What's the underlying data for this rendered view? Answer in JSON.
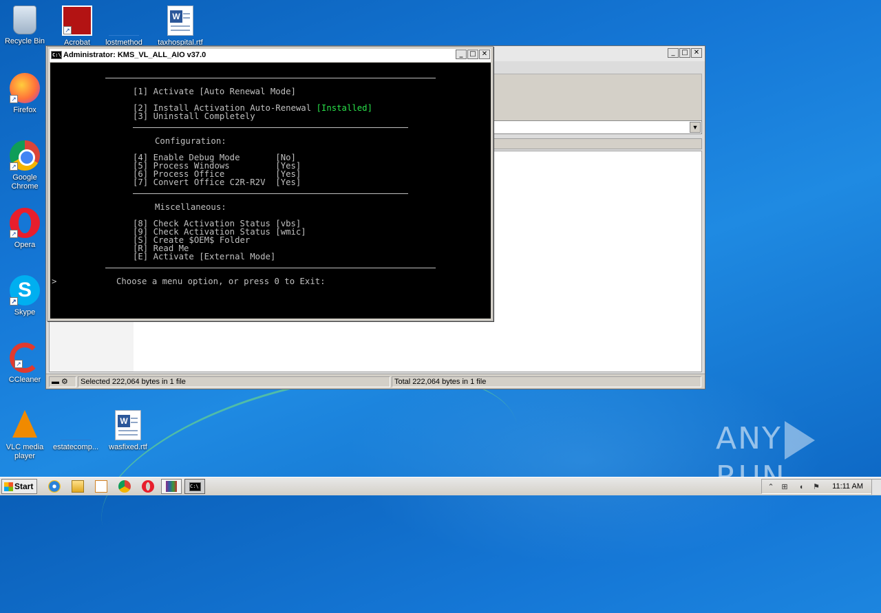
{
  "desktop": {
    "icons": [
      {
        "label": "Recycle Bin",
        "icon": "recycle-bin-icon"
      },
      {
        "label": "Acrobat",
        "icon": "acrobat-icon"
      },
      {
        "label": "lostmethod",
        "icon": "file-icon"
      },
      {
        "label": "taxhospital.rtf",
        "icon": "word-document-icon"
      },
      {
        "label": "Firefox",
        "icon": "firefox-icon"
      },
      {
        "label": "Google Chrome",
        "icon": "chrome-icon"
      },
      {
        "label": "Opera",
        "icon": "opera-icon"
      },
      {
        "label": "Skype",
        "icon": "skype-icon"
      },
      {
        "label": "CCleaner",
        "icon": "ccleaner-icon"
      },
      {
        "label": "VLC media player",
        "icon": "vlc-icon"
      },
      {
        "label": "estatecomp...",
        "icon": "file-icon"
      },
      {
        "label": "wasfixed.rtf",
        "icon": "word-document-icon"
      }
    ]
  },
  "console": {
    "title": "Administrator:  KMS_VL_ALL_AIO v37.0",
    "lines": {
      "opt1": "[1] Activate [Auto Renewal Mode]",
      "opt2": "[2] Install Activation Auto-Renewal ",
      "opt2_status": "[Installed]",
      "opt3": "[3] Uninstall Completely",
      "config_header": "Configuration:",
      "opt4": "[4] Enable Debug Mode       [No]",
      "opt5": "[5] Process Windows         [Yes]",
      "opt6": "[6] Process Office          [Yes]",
      "opt7": "[7] Convert Office C2R-R2V  [Yes]",
      "misc_header": "Miscellaneous:",
      "opt8": "[8] Check Activation Status [vbs]",
      "opt9": "[9] Check Activation Status [wmic]",
      "optS": "[S] Create $OEM$ Folder",
      "optR": "[R] Read Me",
      "optE": "[E] Activate [External Mode]",
      "prompt_marker": ">",
      "prompt": "Choose a menu option, or press 0 to Exit:"
    },
    "colors": {
      "background": "#000000",
      "text": "#c0c0c0",
      "highlight": "#29e04a"
    }
  },
  "explorer": {
    "status_selected": "Selected 222,064 bytes in 1 file",
    "status_total": "Total 222,064 bytes in 1 file"
  },
  "window_buttons": {
    "minimize": "_",
    "maximize": "□",
    "close": "✕"
  },
  "taskbar": {
    "start_label": "Start",
    "clock": "11:11 AM"
  },
  "watermark": {
    "left": "ANY",
    "right": "RUN"
  }
}
